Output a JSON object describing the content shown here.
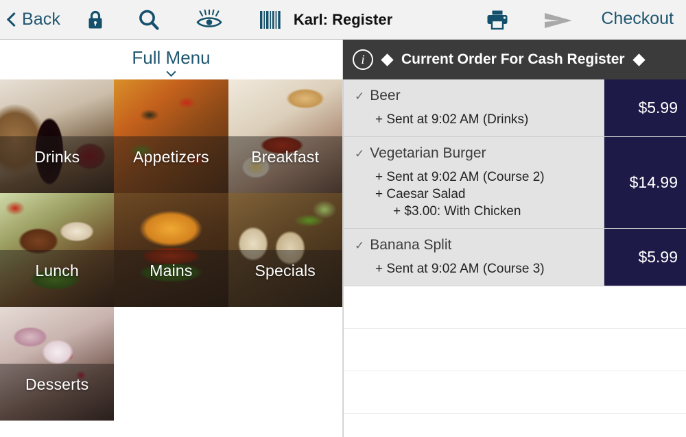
{
  "toolbar": {
    "back_label": "Back",
    "title": "Karl: Register",
    "checkout_label": "Checkout",
    "icons": {
      "lock": "lock-icon",
      "search": "search-icon",
      "eye": "eye-icon",
      "barcode": "barcode-icon",
      "print": "print-icon",
      "send": "send-icon"
    },
    "accent_color": "#1f5670",
    "send_disabled_color": "#a9a9a9",
    "background": "#f2f2f2"
  },
  "menu": {
    "header_title": "Full Menu",
    "chevron": "chevron-down-icon",
    "tiles": [
      {
        "label": "Drinks",
        "photo": "ph-drinks"
      },
      {
        "label": "Appetizers",
        "photo": "ph-appetizers"
      },
      {
        "label": "Breakfast",
        "photo": "ph-breakfast"
      },
      {
        "label": "Lunch",
        "photo": "ph-lunch"
      },
      {
        "label": "Mains",
        "photo": "ph-mains"
      },
      {
        "label": "Specials",
        "photo": "ph-specials"
      },
      {
        "label": "Desserts",
        "photo": "ph-desserts"
      }
    ]
  },
  "order": {
    "header": {
      "info_glyph": "i",
      "title": "Current Order For Cash Register",
      "left_marker": "diamond-icon",
      "right_marker": "diamond-icon",
      "background": "#3b3b3b"
    },
    "check_glyph": "✓",
    "price_badge_color": "#1e1a47",
    "row_background": "#e3e3e3",
    "items": [
      {
        "name": "Beer",
        "price": "$5.99",
        "mods": [
          {
            "text": "+ Sent at 9:02 AM (Drinks)",
            "indent": 0
          }
        ]
      },
      {
        "name": "Vegetarian Burger",
        "price": "$14.99",
        "mods": [
          {
            "text": "+ Sent at 9:02 AM (Course 2)",
            "indent": 0
          },
          {
            "text": "+ Caesar Salad",
            "indent": 0
          },
          {
            "text": "+ $3.00: With Chicken",
            "indent": 1
          }
        ]
      },
      {
        "name": "Banana Split",
        "price": "$5.99",
        "mods": [
          {
            "text": "+ Sent at 9:02 AM (Course 3)",
            "indent": 0
          }
        ]
      }
    ],
    "empty_row_count": 3
  }
}
